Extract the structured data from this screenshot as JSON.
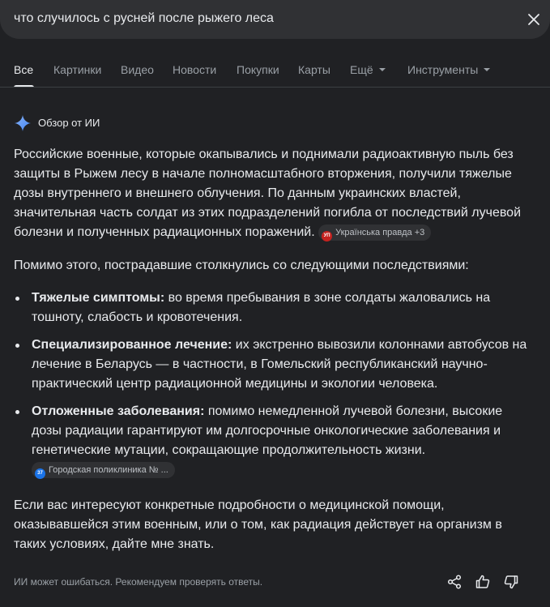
{
  "search": {
    "query": "что случилось с русней после рыжего леса"
  },
  "tabs": [
    {
      "label": "Все"
    },
    {
      "label": "Картинки"
    },
    {
      "label": "Видео"
    },
    {
      "label": "Новости"
    },
    {
      "label": "Покупки"
    },
    {
      "label": "Карты"
    },
    {
      "label": "Ещё"
    },
    {
      "label": "Инструменты"
    }
  ],
  "ai_overview": {
    "title": "Обзор от ИИ",
    "intro": "Российские военные, которые окапывались и поднимали радиоактивную пыль без защиты в Рыжем лесу в начале полномасштабного вторжения, получили тяжелые дозы внутреннего и внешнего облучения. По данным украинских властей, значительная часть солдат из этих подразделений погибла от последствий лучевой болезни и полученных радиационных поражений.",
    "intro_cite": {
      "label": "Українська правда +3",
      "favicon_text": "УП"
    },
    "lead": "Помимо этого, пострадавшие столкнулись со следующими последствиями:",
    "bullets": [
      {
        "term": "Тяжелые симптомы:",
        "text": " во время пребывания в зоне солдаты жаловались на тошноту, слабость и кровотечения."
      },
      {
        "term": "Специализированное лечение:",
        "text": " их экстренно вывозили колоннами автобусов на лечение в Беларусь — в частности, в Гомельский республиканский научно-практический центр радиационной медицины и экологии человека."
      },
      {
        "term": "Отложенные заболевания:",
        "text": " помимо немедленной лучевой болезни, высокие дозы радиации гарантируют им долгосрочные онкологические заболевания и генетические мутации, сокращающие продолжительность жизни.",
        "cite": {
          "label": "Городская поликлиника № ...",
          "favicon_text": "37"
        }
      }
    ],
    "closing": "Если вас интересуют конкретные подробности о медицинской помощи, оказывавшейся этим военным, или о том, как радиация действует на организм в таких условиях, дайте мне знать.",
    "disclaimer": "ИИ может ошибаться. Рекомендуем проверять ответы."
  },
  "colors": {
    "background": "#202124",
    "searchbar": "#303134",
    "text": "#e8eaed",
    "muted": "#9aa0a6",
    "spark": "#8ab4f8",
    "favicon_up": "#c5221f",
    "favicon_clinic": "#1a73e8"
  },
  "icons": [
    "close-icon",
    "sparkle-icon",
    "share-icon",
    "thumbs-up-icon",
    "thumbs-down-icon"
  ]
}
